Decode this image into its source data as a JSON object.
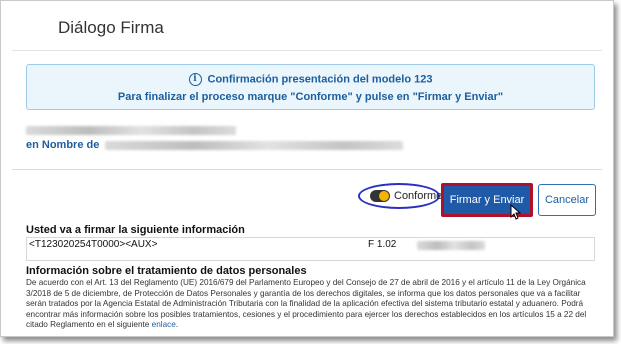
{
  "dialog": {
    "title": "Diálogo Firma"
  },
  "banner": {
    "heading": "Confirmación presentación del modelo 123",
    "instruction": "Para finalizar el proceso marque \"Conforme\" y pulse en \"Firmar y Enviar\"",
    "icon": "info-icon"
  },
  "signer": {
    "on_behalf_label": "en Nombre de"
  },
  "actions": {
    "toggle_label": "Conforme",
    "toggle_checked": true,
    "sign_button": "Firmar y Enviar",
    "cancel_button": "Cancelar"
  },
  "signature": {
    "heading": "Usted va a firmar la siguiente información",
    "code": "<T123020254T0000><AUX>",
    "version": "F 1.02"
  },
  "privacy": {
    "heading": "Información sobre el tratamiento de datos personales",
    "body": "De acuerdo con el Art. 13 del Reglamento (UE) 2016/679 del Parlamento Europeo y del Consejo de 27 de abril de 2016 y el artículo 11 de la Ley Orgánica 3/2018 de 5 de diciembre, de Protección de Datos Personales y garantía de los derechos digitales, se informa que los datos personales que va a facilitar serán tratados por la Agencia Estatal de Administración Tributaria con la finalidad de la aplicación efectiva del sistema tributario estatal y aduanero. Podrá encontrar más información sobre los posibles tratamientos, cesiones y el procedimiento para ejercer los derechos establecidos en los artículos 15 a 22 del citado Reglamento en el siguiente",
    "link": "enlace",
    "end": "."
  },
  "colors": {
    "accent": "#1c5e9e",
    "sign_button_bg": "#1e5aa8",
    "highlight_red": "#b0102a",
    "highlight_blue": "#2b2fc4",
    "banner_bg": "#eaf5fc"
  }
}
